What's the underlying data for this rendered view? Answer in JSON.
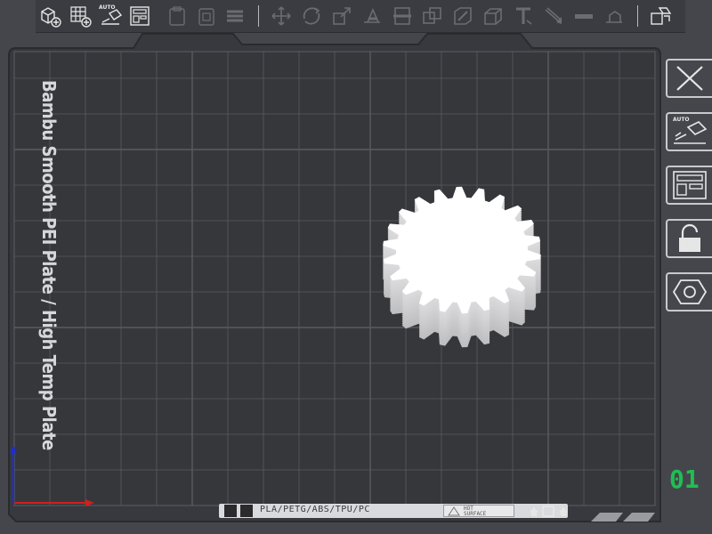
{
  "toolbar": {
    "auto_badge": "AUTO",
    "buttons": [
      {
        "name": "add-object-icon"
      },
      {
        "name": "add-plate-icon"
      },
      {
        "name": "auto-orient-icon"
      },
      {
        "name": "arrange-icon"
      },
      {
        "name": "split-objects-icon"
      },
      {
        "name": "split-parts-icon"
      },
      {
        "name": "layers-icon"
      },
      {
        "name": "move-icon"
      },
      {
        "name": "rotate-icon"
      },
      {
        "name": "scale-icon"
      },
      {
        "name": "place-on-face-icon"
      },
      {
        "name": "cut-icon"
      },
      {
        "name": "mesh-boolean-icon"
      },
      {
        "name": "support-paint-icon"
      },
      {
        "name": "seam-paint-icon"
      },
      {
        "name": "text-emboss-icon"
      },
      {
        "name": "color-paint-icon"
      },
      {
        "name": "measure-icon"
      },
      {
        "name": "assembly-icon"
      },
      {
        "name": "explode-view-icon"
      }
    ]
  },
  "plate": {
    "label": "Bambu Smooth PEI Plate / High Temp Plate",
    "filament_types": "PLA/PETG/ABS/TPU/PC",
    "hot_surface_line1": "HOT",
    "hot_surface_line2": "SURFACE"
  },
  "side_buttons": [
    {
      "name": "close-plate-icon"
    },
    {
      "name": "auto-orient-plate-icon"
    },
    {
      "name": "arrange-plate-icon"
    },
    {
      "name": "lock-plate-icon"
    },
    {
      "name": "plate-settings-icon"
    }
  ],
  "side_auto_badge": "AUTO",
  "layer_readout": "01",
  "colors": {
    "background": "#45464b",
    "grid": "#5a5b60",
    "axis_x": "#d11f1f",
    "axis_y": "#1a2fd1",
    "gear": "#ffffff",
    "layer_readout": "#1fbf52"
  }
}
